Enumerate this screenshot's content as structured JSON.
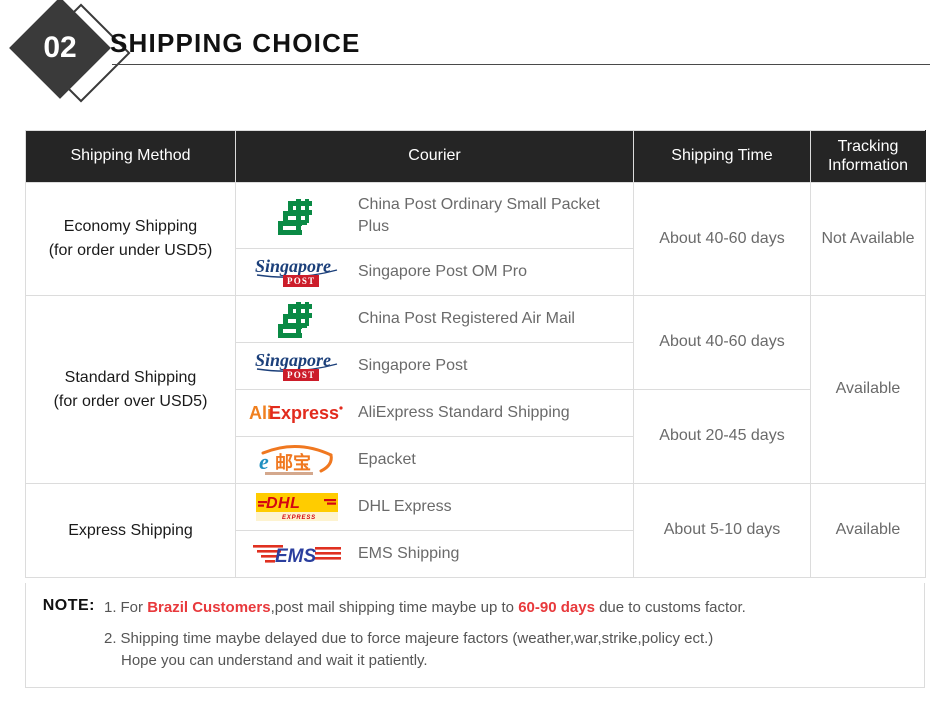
{
  "header": {
    "number": "02",
    "title": "SHIPPING CHOICE"
  },
  "table": {
    "columns": {
      "method": "Shipping Method",
      "courier": "Courier",
      "time": "Shipping Time",
      "tracking_line1": "Tracking",
      "tracking_line2": "Information"
    },
    "sections": [
      {
        "method_line1": "Economy Shipping",
        "method_line2": "(for order under USD5)",
        "couriers": [
          {
            "logo": "china-post-logo",
            "label": "China Post Ordinary Small Packet Plus"
          },
          {
            "logo": "singapore-post-logo",
            "label": "Singapore Post OM Pro"
          }
        ],
        "times": [
          {
            "label": "About 40-60 days",
            "rows": 2
          }
        ],
        "tracking": "Not Available"
      },
      {
        "method_line1": "Standard Shipping",
        "method_line2": "(for order over USD5)",
        "couriers": [
          {
            "logo": "china-post-logo",
            "label": "China Post Registered Air Mail"
          },
          {
            "logo": "singapore-post-logo",
            "label": "Singapore Post"
          },
          {
            "logo": "aliexpress-logo",
            "label": "AliExpress Standard Shipping"
          },
          {
            "logo": "epacket-logo",
            "label": "Epacket"
          }
        ],
        "times": [
          {
            "label": "About 40-60 days",
            "rows": 2
          },
          {
            "label": "About 20-45 days",
            "rows": 2
          }
        ],
        "tracking": "Available"
      },
      {
        "method_line1": "Express Shipping",
        "method_line2": "",
        "couriers": [
          {
            "logo": "dhl-logo",
            "label": "DHL Express"
          },
          {
            "logo": "ems-logo",
            "label": "EMS Shipping"
          }
        ],
        "times": [
          {
            "label": "About 5-10 days",
            "rows": 2
          }
        ],
        "tracking": "Available"
      }
    ]
  },
  "note": {
    "label": "NOTE:",
    "item1": {
      "number": "1.",
      "part1": "For ",
      "highlight1": "Brazil Customers",
      "part2": ",post mail shipping time maybe up to ",
      "highlight2": "60-90 days",
      "part3": " due to customs factor."
    },
    "item2": {
      "number": "2.",
      "line1": "Shipping time maybe delayed due to force majeure factors (weather,war,strike,policy ect.)",
      "line2": "Hope you can understand and wait it patiently."
    }
  },
  "colors": {
    "header_dark": "#252525",
    "accent_red": "#e8393c",
    "china_post_green": "#0a8a45",
    "singapore_navy": "#1b3f7a",
    "singapore_red": "#cc1d2a",
    "aliexpress_orange": "#f08020",
    "aliexpress_red": "#e22b1d",
    "epacket_teal": "#1f8fc0",
    "epacket_orange": "#f07820",
    "dhl_yellow": "#ffcc00",
    "dhl_red": "#d40511",
    "ems_blue": "#2b3f9e",
    "ems_red": "#e03020"
  }
}
